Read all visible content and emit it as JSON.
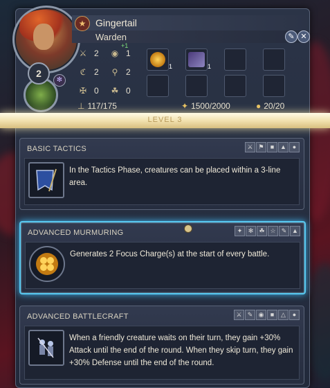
{
  "hero": {
    "name": "Gingertail",
    "class": "Warden",
    "level": "2",
    "stats": {
      "attack": "2",
      "defense": "1",
      "defense_bonus": "+1",
      "spellpower": "2",
      "knowledge": "2",
      "luck": "0",
      "morale": "0"
    },
    "movement": "117/175",
    "experience": "1500/2000",
    "mana": "20/20",
    "inventory": [
      {
        "icon": "golden-clover-icon",
        "count": "1"
      },
      {
        "icon": "claw-weapon-icon",
        "count": "1"
      }
    ]
  },
  "banner": {
    "text": "LEVEL 3"
  },
  "skills": [
    {
      "title": "BASIC TACTICS",
      "description": "In the Tactics Phase, creatures can be placed within a 3-line area.",
      "icon": "blue-banner-icon"
    },
    {
      "title": "ADVANCED MURMURING",
      "description": "Generates 2 Focus Charge(s) at the start of every battle.",
      "icon": "golden-clover-icon"
    },
    {
      "title": "ADVANCED BATTLECRAFT",
      "description": "When a friendly creature waits on their turn, they gain +30% Attack until the end of the round. When they skip turn, they gain +30% Defense until the end of the round.",
      "icon": "soldiers-icon"
    }
  ],
  "colors": {
    "accent": "#57c8f0",
    "banner": "#f2e2b0",
    "panel": "#2b3447"
  }
}
